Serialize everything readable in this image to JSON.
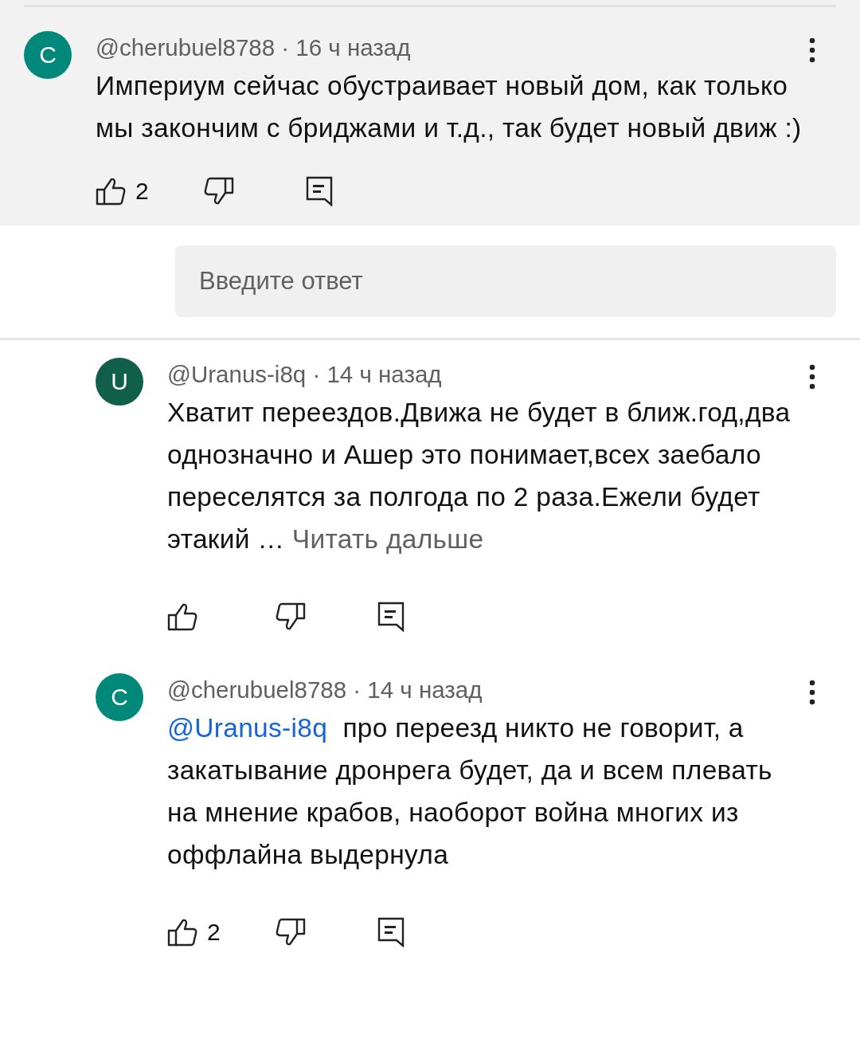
{
  "comments": [
    {
      "kind": "top",
      "highlighted": true,
      "avatar_letter": "C",
      "color": "#00897b",
      "author": "@cherubuel8788",
      "separator": "·",
      "time": "16 ч назад",
      "text": "Империум сейчас обустраивает новый дом, как только мы закончим с бриджами и т.д., так будет новый движ :)",
      "likes": "2"
    },
    {
      "kind": "reply",
      "highlighted": false,
      "avatar_letter": "U",
      "color": "#0f5f4a",
      "author": "@Uranus-i8q",
      "separator": "·",
      "time": "14 ч назад",
      "text": "Хватит переездов.Движа не будет в ближ.год,два однозначно и Ашер это понимает,всех заебало переселятся за полгода по 2 раза.Ежели будет этакий …",
      "read_more": "Читать дальше"
    },
    {
      "kind": "reply",
      "highlighted": false,
      "avatar_letter": "C",
      "color": "#00897b",
      "author": "@cherubuel8788",
      "separator": "·",
      "time": "14 ч назад",
      "mention": "@Uranus-i8q",
      "text": "про переезд никто не говорит, а закатывание дронрега будет, да и всем плевать на мнение крабов, наоборот война многих из оффлайна выдернула",
      "likes": "2"
    }
  ],
  "reply_field": {
    "placeholder": "Введите ответ"
  }
}
